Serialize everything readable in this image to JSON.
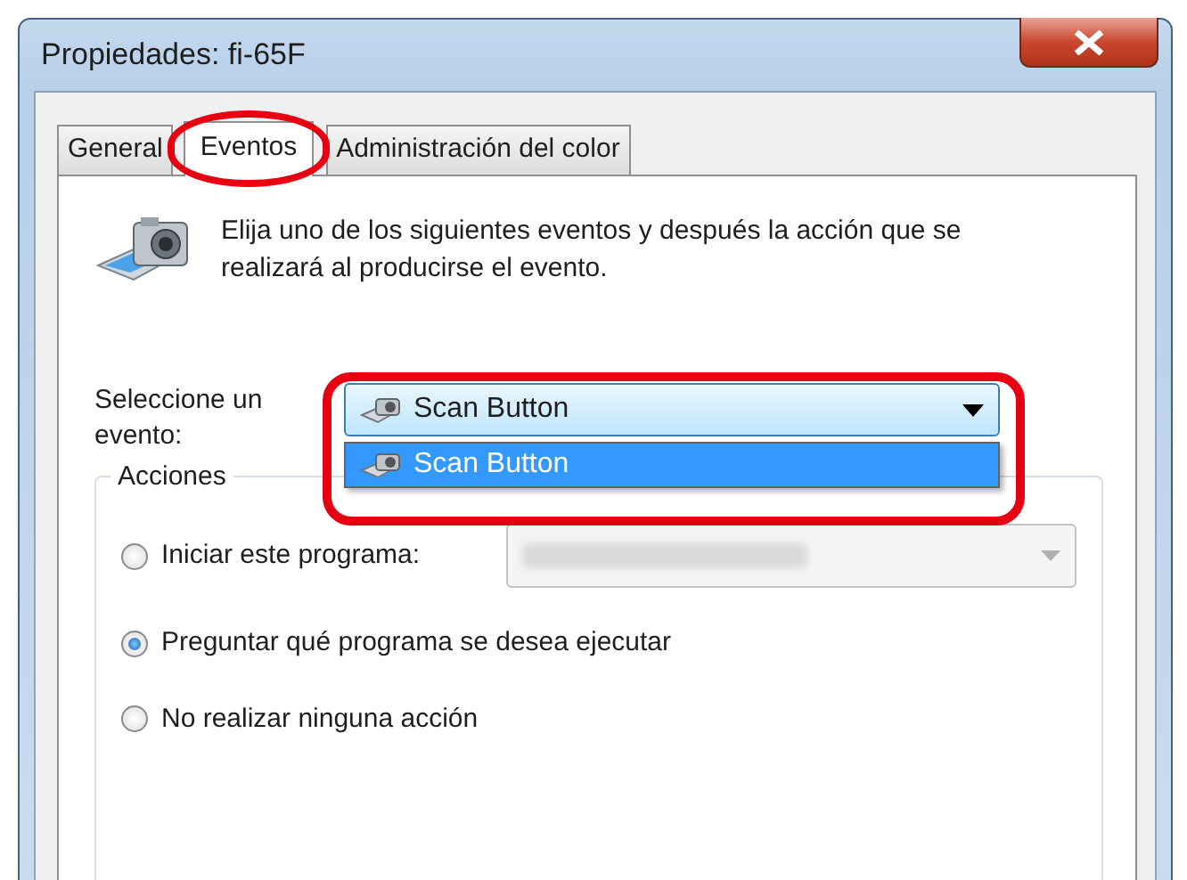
{
  "window": {
    "title": "Propiedades: fi-65F"
  },
  "tabs": [
    {
      "label": "General",
      "selected": false,
      "highlighted": false
    },
    {
      "label": "Eventos",
      "selected": true,
      "highlighted": true
    },
    {
      "label": "Administración del color",
      "selected": false,
      "highlighted": false
    }
  ],
  "description": "Elija uno de los siguientes eventos y después la acción que se realizará al producirse el evento.",
  "event_select": {
    "label": "Seleccione un evento:",
    "value": "Scan Button",
    "expanded": true,
    "highlighted": true,
    "options": [
      {
        "label": "Scan Button",
        "selected": true
      }
    ]
  },
  "actions": {
    "title": "Acciones",
    "options": [
      {
        "kind": "program",
        "label": "Iniciar este programa:",
        "selected": false
      },
      {
        "kind": "plain",
        "label": "Preguntar qué programa se desea ejecutar",
        "selected": true
      },
      {
        "kind": "plain",
        "label": "No realizar ninguna acción",
        "selected": false
      }
    ],
    "program_select": {
      "disabled": true
    }
  }
}
